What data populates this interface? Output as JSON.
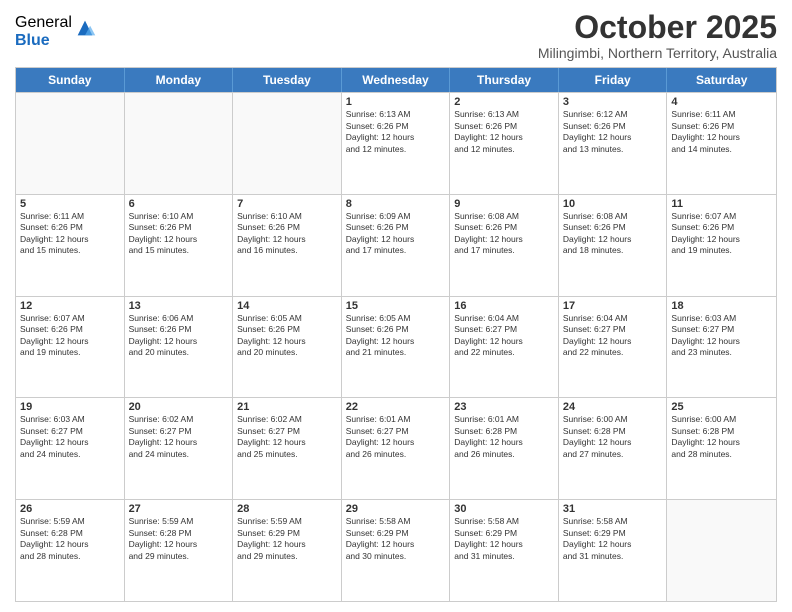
{
  "logo": {
    "general": "General",
    "blue": "Blue"
  },
  "title": "October 2025",
  "subtitle": "Milingimbi, Northern Territory, Australia",
  "header_days": [
    "Sunday",
    "Monday",
    "Tuesday",
    "Wednesday",
    "Thursday",
    "Friday",
    "Saturday"
  ],
  "weeks": [
    [
      {
        "day": "",
        "info": ""
      },
      {
        "day": "",
        "info": ""
      },
      {
        "day": "",
        "info": ""
      },
      {
        "day": "1",
        "info": "Sunrise: 6:13 AM\nSunset: 6:26 PM\nDaylight: 12 hours\nand 12 minutes."
      },
      {
        "day": "2",
        "info": "Sunrise: 6:13 AM\nSunset: 6:26 PM\nDaylight: 12 hours\nand 12 minutes."
      },
      {
        "day": "3",
        "info": "Sunrise: 6:12 AM\nSunset: 6:26 PM\nDaylight: 12 hours\nand 13 minutes."
      },
      {
        "day": "4",
        "info": "Sunrise: 6:11 AM\nSunset: 6:26 PM\nDaylight: 12 hours\nand 14 minutes."
      }
    ],
    [
      {
        "day": "5",
        "info": "Sunrise: 6:11 AM\nSunset: 6:26 PM\nDaylight: 12 hours\nand 15 minutes."
      },
      {
        "day": "6",
        "info": "Sunrise: 6:10 AM\nSunset: 6:26 PM\nDaylight: 12 hours\nand 15 minutes."
      },
      {
        "day": "7",
        "info": "Sunrise: 6:10 AM\nSunset: 6:26 PM\nDaylight: 12 hours\nand 16 minutes."
      },
      {
        "day": "8",
        "info": "Sunrise: 6:09 AM\nSunset: 6:26 PM\nDaylight: 12 hours\nand 17 minutes."
      },
      {
        "day": "9",
        "info": "Sunrise: 6:08 AM\nSunset: 6:26 PM\nDaylight: 12 hours\nand 17 minutes."
      },
      {
        "day": "10",
        "info": "Sunrise: 6:08 AM\nSunset: 6:26 PM\nDaylight: 12 hours\nand 18 minutes."
      },
      {
        "day": "11",
        "info": "Sunrise: 6:07 AM\nSunset: 6:26 PM\nDaylight: 12 hours\nand 19 minutes."
      }
    ],
    [
      {
        "day": "12",
        "info": "Sunrise: 6:07 AM\nSunset: 6:26 PM\nDaylight: 12 hours\nand 19 minutes."
      },
      {
        "day": "13",
        "info": "Sunrise: 6:06 AM\nSunset: 6:26 PM\nDaylight: 12 hours\nand 20 minutes."
      },
      {
        "day": "14",
        "info": "Sunrise: 6:05 AM\nSunset: 6:26 PM\nDaylight: 12 hours\nand 20 minutes."
      },
      {
        "day": "15",
        "info": "Sunrise: 6:05 AM\nSunset: 6:26 PM\nDaylight: 12 hours\nand 21 minutes."
      },
      {
        "day": "16",
        "info": "Sunrise: 6:04 AM\nSunset: 6:27 PM\nDaylight: 12 hours\nand 22 minutes."
      },
      {
        "day": "17",
        "info": "Sunrise: 6:04 AM\nSunset: 6:27 PM\nDaylight: 12 hours\nand 22 minutes."
      },
      {
        "day": "18",
        "info": "Sunrise: 6:03 AM\nSunset: 6:27 PM\nDaylight: 12 hours\nand 23 minutes."
      }
    ],
    [
      {
        "day": "19",
        "info": "Sunrise: 6:03 AM\nSunset: 6:27 PM\nDaylight: 12 hours\nand 24 minutes."
      },
      {
        "day": "20",
        "info": "Sunrise: 6:02 AM\nSunset: 6:27 PM\nDaylight: 12 hours\nand 24 minutes."
      },
      {
        "day": "21",
        "info": "Sunrise: 6:02 AM\nSunset: 6:27 PM\nDaylight: 12 hours\nand 25 minutes."
      },
      {
        "day": "22",
        "info": "Sunrise: 6:01 AM\nSunset: 6:27 PM\nDaylight: 12 hours\nand 26 minutes."
      },
      {
        "day": "23",
        "info": "Sunrise: 6:01 AM\nSunset: 6:28 PM\nDaylight: 12 hours\nand 26 minutes."
      },
      {
        "day": "24",
        "info": "Sunrise: 6:00 AM\nSunset: 6:28 PM\nDaylight: 12 hours\nand 27 minutes."
      },
      {
        "day": "25",
        "info": "Sunrise: 6:00 AM\nSunset: 6:28 PM\nDaylight: 12 hours\nand 28 minutes."
      }
    ],
    [
      {
        "day": "26",
        "info": "Sunrise: 5:59 AM\nSunset: 6:28 PM\nDaylight: 12 hours\nand 28 minutes."
      },
      {
        "day": "27",
        "info": "Sunrise: 5:59 AM\nSunset: 6:28 PM\nDaylight: 12 hours\nand 29 minutes."
      },
      {
        "day": "28",
        "info": "Sunrise: 5:59 AM\nSunset: 6:29 PM\nDaylight: 12 hours\nand 29 minutes."
      },
      {
        "day": "29",
        "info": "Sunrise: 5:58 AM\nSunset: 6:29 PM\nDaylight: 12 hours\nand 30 minutes."
      },
      {
        "day": "30",
        "info": "Sunrise: 5:58 AM\nSunset: 6:29 PM\nDaylight: 12 hours\nand 31 minutes."
      },
      {
        "day": "31",
        "info": "Sunrise: 5:58 AM\nSunset: 6:29 PM\nDaylight: 12 hours\nand 31 minutes."
      },
      {
        "day": "",
        "info": ""
      }
    ]
  ]
}
